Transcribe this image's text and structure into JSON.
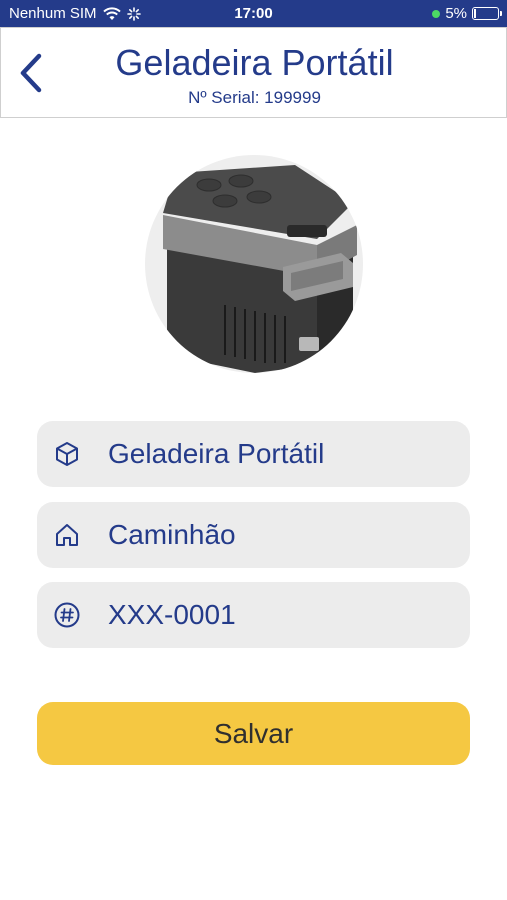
{
  "status_bar": {
    "carrier": "Nenhum SIM",
    "time": "17:00",
    "battery": "5%",
    "icons": [
      "wifi-icon",
      "activity-spinner-icon",
      "charging-dot-icon",
      "battery-icon"
    ]
  },
  "header": {
    "title": "Geladeira Portátil",
    "serial": "Nº Serial: 199999",
    "back_icon": "chevron-left-icon"
  },
  "product_image": "portable-fridge-image",
  "fields": [
    {
      "icon": "cube-icon",
      "value": "Geladeira Portátil"
    },
    {
      "icon": "home-icon",
      "value": "Caminhão"
    },
    {
      "icon": "hashtag-icon",
      "value": "XXX-0001"
    }
  ],
  "save_label": "Salvar",
  "colors": {
    "primary": "#243b8a",
    "accent": "#f5c842",
    "field_bg": "#ececec"
  }
}
